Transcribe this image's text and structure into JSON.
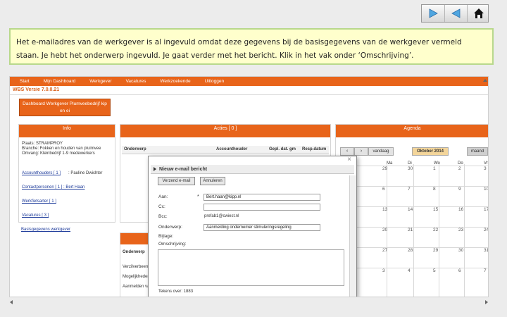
{
  "nav": {
    "icons": [
      "play-forward-icon",
      "play-back-icon",
      "home-icon"
    ]
  },
  "instruction": "Het e-mailadres van de werkgever is al ingevuld omdat deze gegevens bij de basisgegevens van de werkgever vermeld staan. Je hebt het onderwerp ingevuld. Je gaat verder met het bericht. Klik in het vak onder ‘Omschrijving’.",
  "app": {
    "menu": [
      "Start",
      "Mijn Dashboard",
      "Werkgever",
      "Vacatures",
      "Werkzoekende",
      "Uitloggen"
    ],
    "version": "WBS Versie 7.0.0.21",
    "dashboard_btn": "Dashboard Werkgever Plumveebedrijf kip en ei",
    "info": {
      "title": "Info",
      "lines": [
        "Plaats: STRAMPROY",
        "Branche: Fokken en houden van pluimvee",
        "Omvang: Kleinbedrijf 1-9 medewerkers"
      ],
      "link_contact": "Accounthouders [ 1 ]",
      "contact_name": ": Pauline Dwichter",
      "link_persons": "Contactpersonen [ 1 ] : Bert Haan",
      "link_werkf": "Werkfietsarter [ 1 ]",
      "link_vac": "Vacatures [ 3 ]",
      "link_basis": "Basisgegevens werkgever"
    },
    "acties": {
      "title": "Acties [ 0 ]",
      "cols": [
        "Onderwerp",
        "Accounthouder",
        "Gepl. dat. gm",
        "Resp.datum"
      ]
    },
    "agenda": {
      "title": "Agenda",
      "today": "vandaag",
      "month": "Oktober 2014",
      "view": "maand",
      "days": [
        "Ma",
        "Di",
        "Wo",
        "Do",
        "Vr"
      ],
      "rows": [
        [
          "29",
          "30",
          "1",
          "2",
          "3"
        ],
        [
          "6",
          "7",
          "8",
          "9",
          "10"
        ],
        [
          "13",
          "14",
          "15",
          "16",
          "17"
        ],
        [
          "20",
          "21",
          "22",
          "23",
          "24"
        ],
        [
          "27",
          "28",
          "29",
          "30",
          "31"
        ],
        [
          "3",
          "4",
          "5",
          "6",
          "7"
        ]
      ]
    },
    "bottom": {
      "col": "Onderwerp",
      "rows": [
        "Verzilverbeen",
        "Mogelijkheden",
        "Aanmelden vacatures"
      ]
    },
    "dialog": {
      "title": "Nieuw e-mail bericht",
      "send": "Verzend e-mail",
      "cancel": "Annuleren",
      "labels": {
        "to": "Aan:",
        "cc": "Cc:",
        "bcc": "Bcc:",
        "subject": "Onderwerp:",
        "attach": "Bijlage:",
        "desc": "Omschrijving:"
      },
      "required": "*",
      "to_value": "Bert.haan@kipp.nl",
      "cc_value": "",
      "bcc_value": "prefab1@cwiest.nl",
      "subject_value": "Aanmelding ondernemer stimuleringsregeling",
      "count": "Tekens over: 1883"
    }
  }
}
